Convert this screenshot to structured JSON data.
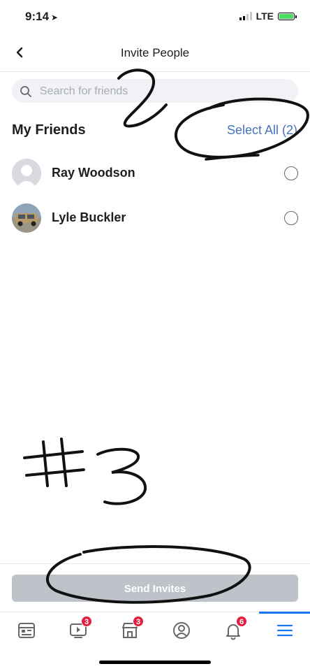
{
  "status_bar": {
    "time": "9:14",
    "network": "LTE"
  },
  "navbar": {
    "title": "Invite People"
  },
  "search": {
    "placeholder": "Search for friends"
  },
  "section": {
    "title": "My Friends",
    "select_all": "Select All (2)"
  },
  "friends": [
    {
      "name": "Ray Woodson",
      "selected": false
    },
    {
      "name": "Lyle Buckler",
      "selected": false
    }
  ],
  "footer": {
    "send_label": "Send Invites"
  },
  "tabbar": {
    "tabs": [
      {
        "icon": "news-feed-icon",
        "badge": ""
      },
      {
        "icon": "watch-icon",
        "badge": "3"
      },
      {
        "icon": "marketplace-icon",
        "badge": "3"
      },
      {
        "icon": "profile-icon",
        "badge": ""
      },
      {
        "icon": "notifications-icon",
        "badge": "6"
      },
      {
        "icon": "menu-icon",
        "badge": ""
      }
    ]
  },
  "annotations": {
    "mark_2": "2",
    "mark_3": "#3"
  },
  "colors": {
    "link": "#4573b8",
    "disabled_button": "#bec3c9",
    "badge": "#e41e3f",
    "active_tab": "#1877f2"
  }
}
